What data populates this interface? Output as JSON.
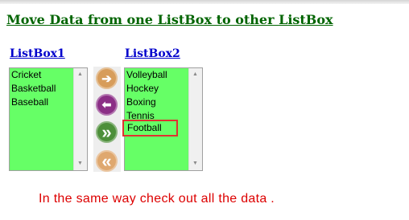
{
  "title": "Move Data from one ListBox to other ListBox",
  "listbox1": {
    "label": "ListBox1",
    "items": [
      "Cricket",
      "Basketball",
      "Baseball"
    ]
  },
  "listbox2": {
    "label": "ListBox2",
    "items": [
      "Volleyball",
      "Hockey",
      "Boxing",
      "Tennis",
      "Football"
    ],
    "highlighted": "Football"
  },
  "buttons": [
    {
      "name": "move-right-icon",
      "glyph": "➔",
      "color": "#d79d5b"
    },
    {
      "name": "move-left-icon",
      "glyph": "⬅",
      "color": "#8b2f86"
    },
    {
      "name": "move-all-right-icon",
      "glyph": "»",
      "color": "#4d8f3a"
    },
    {
      "name": "move-all-left-icon",
      "glyph": "«",
      "color": "#dfa86f"
    }
  ],
  "message": "In the same way check out all the data ."
}
